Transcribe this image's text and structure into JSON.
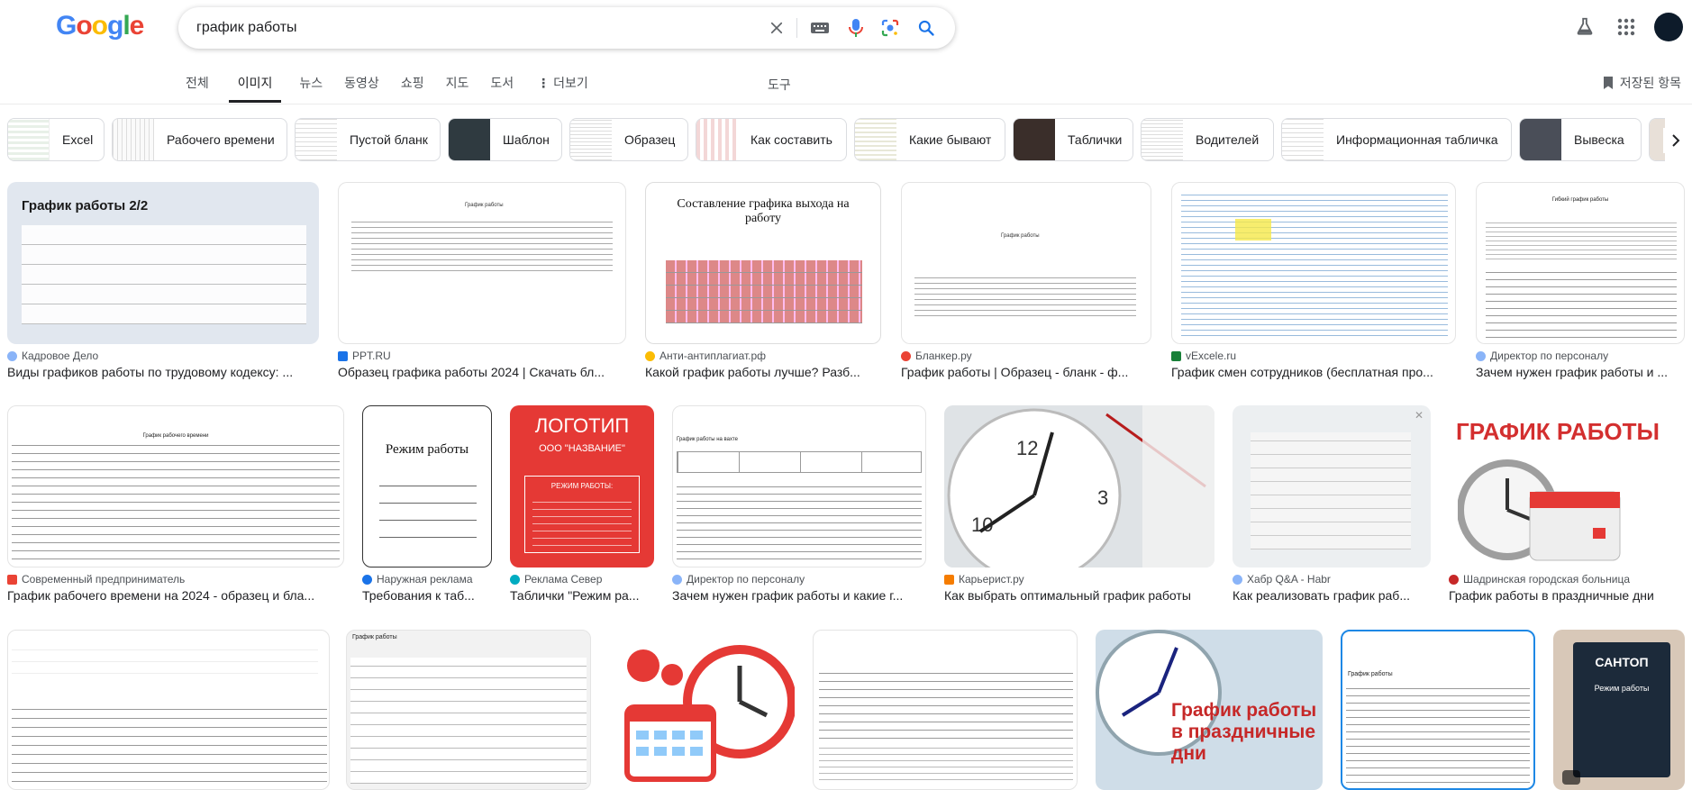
{
  "search": {
    "query": "график работы"
  },
  "tabs": [
    {
      "label": "전체"
    },
    {
      "label": "이미지"
    },
    {
      "label": "뉴스"
    },
    {
      "label": "동영상"
    },
    {
      "label": "쇼핑"
    },
    {
      "label": "지도"
    },
    {
      "label": "도서"
    },
    {
      "label": "더보기"
    }
  ],
  "tools_label": "도구",
  "saved_label": "저장된 항목",
  "chips": [
    {
      "label": "Excel"
    },
    {
      "label": "Рабочего времени"
    },
    {
      "label": "Пустой бланк"
    },
    {
      "label": "Шаблон"
    },
    {
      "label": "Образец"
    },
    {
      "label": "Как составить"
    },
    {
      "label": "Какие бывают"
    },
    {
      "label": "Таблички"
    },
    {
      "label": "Водителей"
    },
    {
      "label": "Информационная табличка"
    },
    {
      "label": "Вывеска"
    }
  ],
  "row1": [
    {
      "source": "Кадровое Дело",
      "title": "Виды графиков работы по трудовому кодексу: ...",
      "img_text": "График работы 2/2",
      "fav_color": "#8ab4f8"
    },
    {
      "source": "PPT.RU",
      "title": "Образец графика работы 2024 | Скачать бл...",
      "img_text": "График работы",
      "fav_color": "#1a73e8"
    },
    {
      "source": "Анти-антиплагиат.рф",
      "title": "Какой график работы лучше? Разб...",
      "img_text": "Составление графика выхода на работу",
      "fav_color": "#fbbc04"
    },
    {
      "source": "Бланкер.ру",
      "title": "График работы | Образец - бланк - ф...",
      "img_text": "График работы",
      "fav_color": "#ea4335"
    },
    {
      "source": "vExcele.ru",
      "title": "График смен сотрудников (бесплатная про...",
      "img_text": "",
      "fav_color": "#188038"
    },
    {
      "source": "Директор по персоналу",
      "title": "Зачем нужен график работы и ...",
      "img_text": "Гибкий график работы",
      "fav_color": "#8ab4f8"
    }
  ],
  "row2": [
    {
      "source": "Современный предприниматель",
      "title": "График рабочего времени на 2024 - образец и бла...",
      "img_text": "График рабочего времени",
      "fav_color": "#ea4335"
    },
    {
      "source": "Наружная реклама",
      "title": "Требования к таб...",
      "img_text": "Режим работы",
      "fav_color": "#1a73e8"
    },
    {
      "source": "Реклама Север",
      "title": "Таблички \"Режим ра...",
      "img_text": "ЛОГОТИП",
      "img_sub": "ООО \"НАЗВАНИЕ\"",
      "img_sub2": "РЕЖИМ РАБОТЫ:",
      "fav_color": "#00acc1"
    },
    {
      "source": "Директор по персоналу",
      "title": "Зачем нужен график работы и какие г...",
      "img_text": "График работы на вахте",
      "fav_color": "#8ab4f8"
    },
    {
      "source": "Карьерист.ру",
      "title": "Как выбрать оптимальный график работы",
      "img_text": "",
      "fav_color": "#f57c00"
    },
    {
      "source": "Хабр Q&A - Habr",
      "title": "Как реализовать график раб...",
      "img_text": "",
      "fav_color": "#8ab4f8"
    },
    {
      "source": "Шадринская городская больница",
      "title": "График работы в праздничные дни",
      "img_text": "ГРАФИК РАБОТЫ",
      "fav_color": "#c62828"
    }
  ],
  "row3": [
    {
      "img_text": ""
    },
    {
      "img_text": "График работы"
    },
    {
      "img_text": ""
    },
    {
      "img_text": ""
    },
    {
      "img_text": "График работы в праздничные дни"
    },
    {
      "img_text": "График работы"
    },
    {
      "img_text": "САНТОП",
      "img_sub": "Режим работы"
    }
  ],
  "colors": {
    "accent": "#1a73e8",
    "red": "#e53935"
  }
}
